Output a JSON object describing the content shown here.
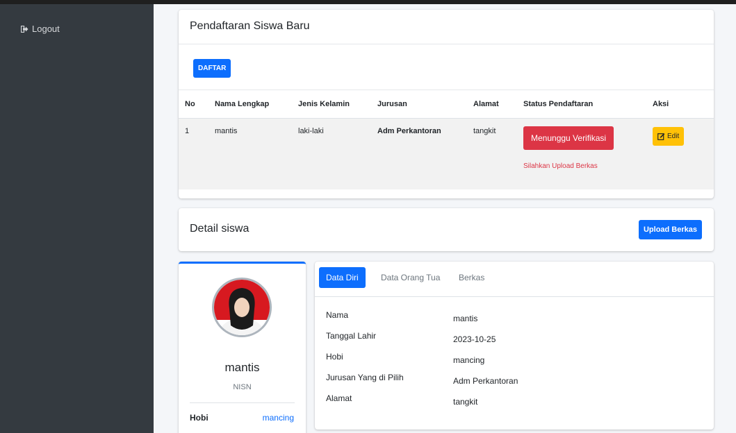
{
  "sidebar": {
    "logout_label": "Logout"
  },
  "registration": {
    "title": "Pendaftaran Siswa Baru",
    "daftar_label": "DAFTAR",
    "columns": [
      "No",
      "Nama Lengkap",
      "Jenis Kelamin",
      "Jurusan",
      "Alamat",
      "Status Pendaftaran",
      "Aksi"
    ],
    "rows": [
      {
        "no": "1",
        "nama": "mantis",
        "jenis_kelamin": "laki-laki",
        "jurusan": "Adm Perkantoran",
        "alamat": "tangkit",
        "status": "Menunggu Verifikasi",
        "status_note": "Silahkan Upload Berkas",
        "edit_label": "Edit"
      }
    ]
  },
  "detail": {
    "title": "Detail siswa",
    "upload_label": "Upload Berkas"
  },
  "profile": {
    "name": "mantis",
    "nisn_label": "NISN",
    "hobi_label": "Hobi",
    "hobi_value": "mancing"
  },
  "tabs": {
    "items": [
      "Data Diri",
      "Data Orang Tua",
      "Berkas"
    ],
    "active": "Data Diri"
  },
  "data_diri": [
    {
      "label": "Nama",
      "value": "mantis"
    },
    {
      "label": "Tanggal Lahir",
      "value": "2023-10-25"
    },
    {
      "label": "Hobi",
      "value": "mancing"
    },
    {
      "label": "Jurusan Yang di Pilih",
      "value": "Adm Perkantoran"
    },
    {
      "label": "Alamat",
      "value": "tangkit"
    }
  ],
  "colors": {
    "primary": "#0d6efd",
    "danger": "#dc3545",
    "warning": "#ffc107",
    "sidebar": "#343a40"
  }
}
